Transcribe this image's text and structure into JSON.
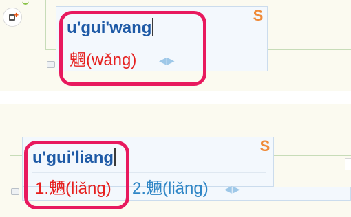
{
  "top_ime": {
    "composition": "u'gui'wang",
    "candidates": [
      {
        "text": "魍(wǎng)"
      }
    ]
  },
  "bottom_ime": {
    "composition": "u'gui'liang",
    "candidates": [
      {
        "text": "1.魉(liǎng)"
      },
      {
        "text": "2.魎(liǎng)"
      }
    ]
  },
  "logo_letter": "S",
  "colors": {
    "composition": "#1e5aa6",
    "selected_candidate": "#e6201f",
    "other_candidate": "#2f86c6",
    "highlight": "#e8195e"
  },
  "icons": [
    "add-icon",
    "sogou-logo-icon",
    "page-prev-icon",
    "page-next-icon",
    "emoji-icon"
  ]
}
